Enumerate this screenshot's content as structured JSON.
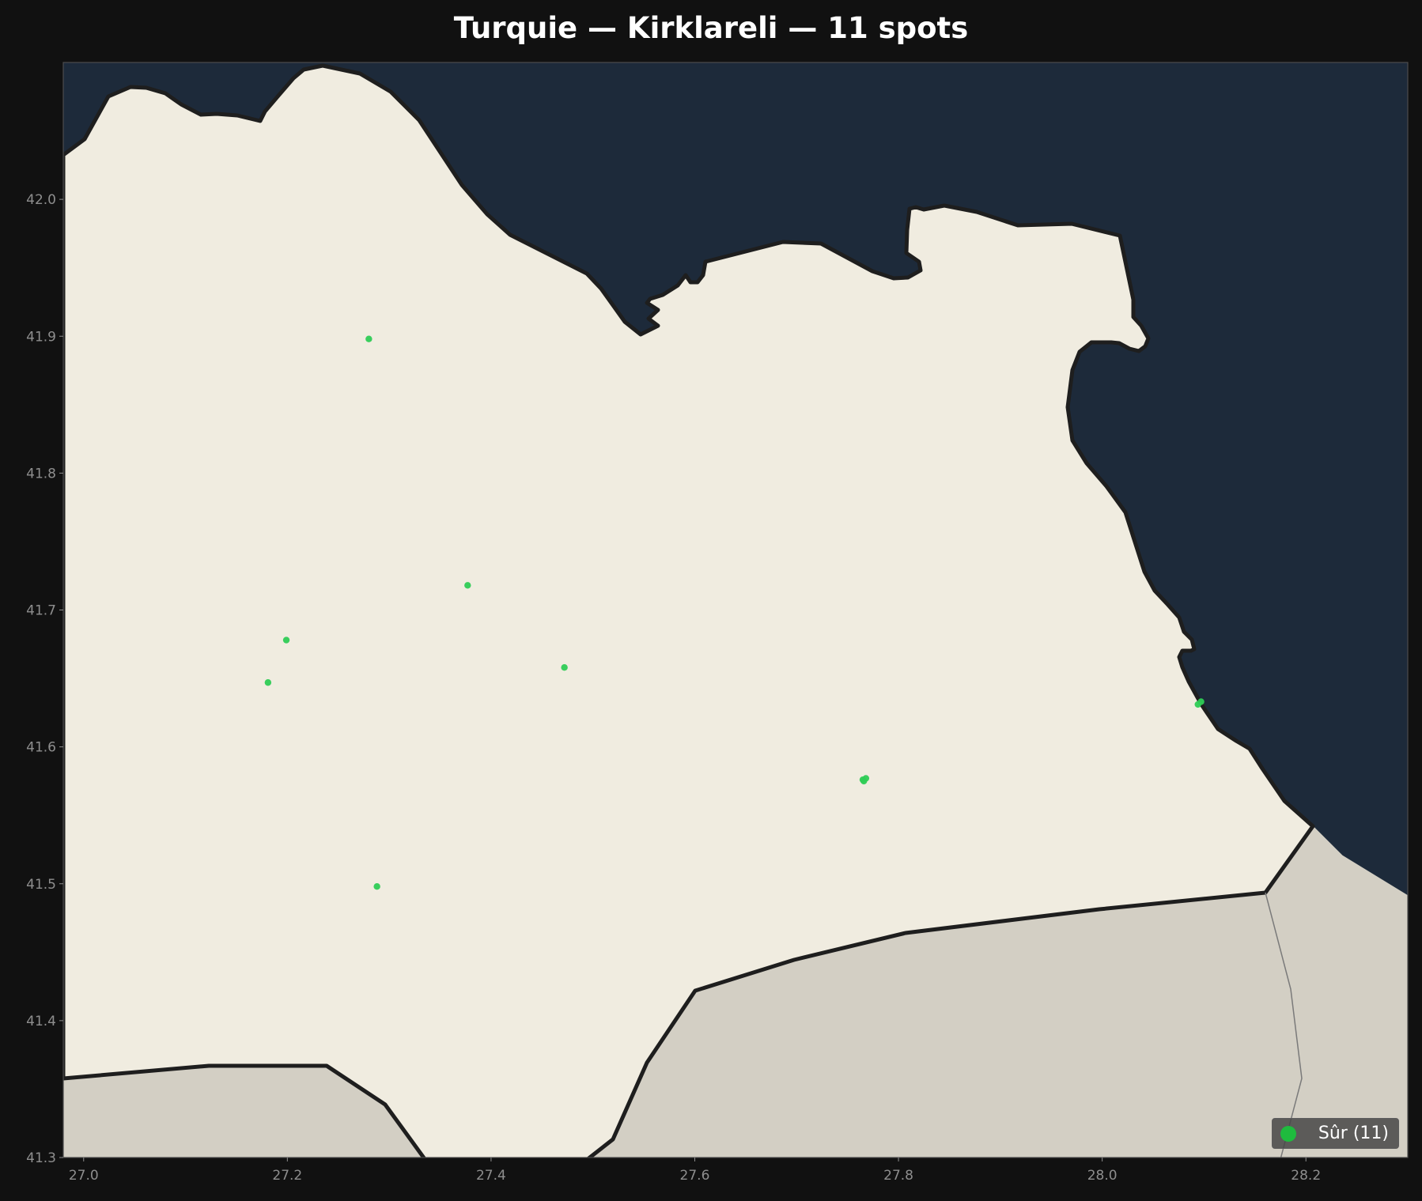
{
  "title": "Turquie — Kirklareli — 11 spots",
  "colors": {
    "figure_bg": "#111111",
    "sea": "#1d2a3a",
    "land": "#f0ece0",
    "neighbor_land": "#d3cfc4",
    "border": "#1e1e1e",
    "spot": "#2ecc55",
    "legend_marker": "#1fbb3e"
  },
  "map": {
    "x_axis": {
      "range": [
        26.98,
        28.3
      ],
      "ticks": [
        27.0,
        27.2,
        27.4,
        27.6,
        27.8,
        28.0,
        28.2
      ]
    },
    "y_axis": {
      "range": [
        41.3,
        42.1
      ],
      "ticks": [
        41.3,
        41.4,
        41.5,
        41.6,
        41.7,
        41.8,
        41.9,
        42.0
      ]
    },
    "spots": [
      {
        "category": "Sûr",
        "lon": 27.28,
        "lat": 41.898
      },
      {
        "category": "Sûr",
        "lon": 27.377,
        "lat": 41.718
      },
      {
        "category": "Sûr",
        "lon": 27.199,
        "lat": 41.678
      },
      {
        "category": "Sûr",
        "lon": 27.181,
        "lat": 41.647
      },
      {
        "category": "Sûr",
        "lon": 27.472,
        "lat": 41.658
      },
      {
        "category": "Sûr",
        "lon": 27.288,
        "lat": 41.498
      },
      {
        "category": "Sûr",
        "lon": 27.765,
        "lat": 41.576
      },
      {
        "category": "Sûr",
        "lon": 27.768,
        "lat": 41.577
      },
      {
        "category": "Sûr",
        "lon": 27.766,
        "lat": 41.575
      },
      {
        "category": "Sûr",
        "lon": 28.094,
        "lat": 41.631
      },
      {
        "category": "Sûr",
        "lon": 28.097,
        "lat": 41.633
      }
    ]
  },
  "legend": {
    "entries": [
      {
        "label": "Sûr (11)"
      }
    ]
  }
}
